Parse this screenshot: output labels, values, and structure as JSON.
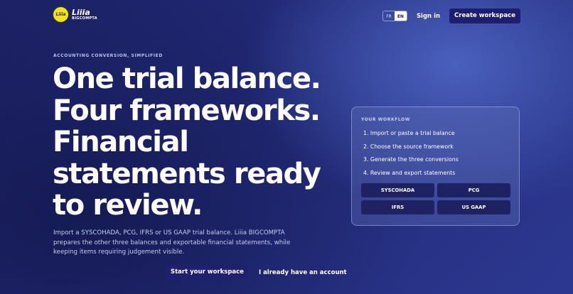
{
  "brand": {
    "badge": "Liiia",
    "name": "Liiia",
    "sub": "BIGCOMPTA"
  },
  "nav": {
    "languages": [
      {
        "code": "FR",
        "active": false
      },
      {
        "code": "EN",
        "active": true
      }
    ],
    "signin": "Sign in",
    "create": "Create workspace"
  },
  "hero": {
    "eyebrow": "ACCOUNTING CONVERSION, SIMPLIFIED",
    "headline_lines": [
      "One trial balance.",
      "Four frameworks.",
      "Financial",
      "statements ready",
      "to review."
    ],
    "description": "Import a SYSCOHADA, PCG, IFRS or US GAAP trial balance. Liiia BIGCOMPTA prepares the other three balances and exportable financial statements, while keeping items requiring judgement visible.",
    "cta_primary": "Start your workspace",
    "cta_secondary": "I already have an account"
  },
  "workflow": {
    "title": "YOUR WORKFLOW",
    "steps": [
      "1. Import or paste a trial balance",
      "2. Choose the source framework",
      "3. Generate the three conversions",
      "4. Review and export statements"
    ],
    "frameworks": [
      "SYSCOHADA",
      "PCG",
      "IFRS",
      "US GAAP"
    ]
  },
  "colors": {
    "accent_yellow": "#f2e21f",
    "button_navy": "#1d1f6e",
    "background": "#232b7a"
  }
}
